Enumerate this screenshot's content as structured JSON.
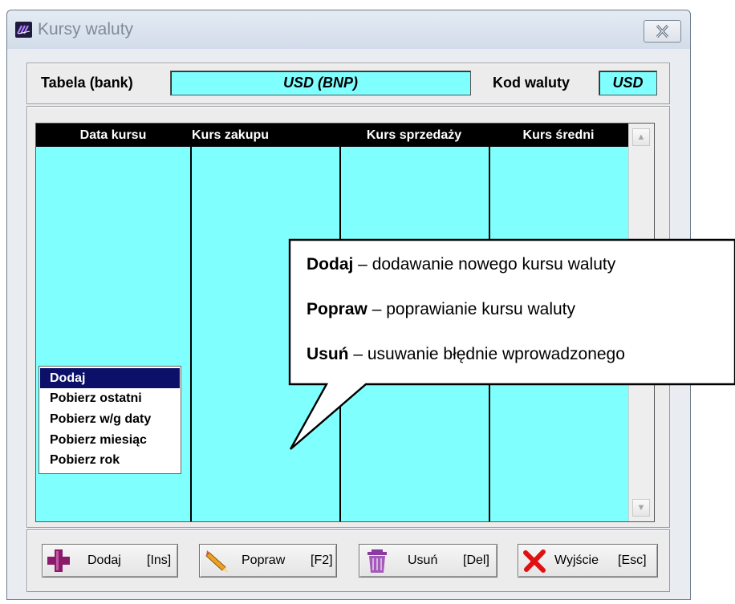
{
  "window": {
    "title": "Kursy waluty"
  },
  "header": {
    "table_label": "Tabela (bank)",
    "table_value": "USD (BNP)",
    "code_label": "Kod waluty",
    "code_value": "USD"
  },
  "grid": {
    "columns": [
      "Data kursu",
      "Kurs zakupu",
      "Kurs sprzedaży",
      "Kurs średni"
    ],
    "rows": []
  },
  "popup_menu": {
    "items": [
      "Dodaj",
      "Pobierz ostatni",
      "Pobierz w/g daty",
      "Pobierz miesiąc",
      "Pobierz rok"
    ],
    "selected": "Dodaj"
  },
  "callout": {
    "lines": [
      {
        "term": "Dodaj",
        "desc": " – dodawanie nowego kursu waluty"
      },
      {
        "term": "Popraw",
        "desc": " – poprawianie kursu waluty"
      },
      {
        "term": "Usuń",
        "desc": " – usuwanie błędnie wprowadzonego"
      }
    ]
  },
  "buttons": {
    "add": {
      "label": "Dodaj",
      "key": "[Ins]"
    },
    "edit": {
      "label": "Popraw",
      "key": "[F2]"
    },
    "delete": {
      "label": "Usuń",
      "key": "[Del]"
    },
    "exit": {
      "label": "Wyjście",
      "key": "[Esc]"
    }
  },
  "colors": {
    "grid_background": "#80ffff",
    "menu_selected": "#0c1068",
    "add_icon": "#8b1a6b",
    "exit_icon": "#e01010"
  },
  "icons": {
    "app": "currency-app-icon",
    "close": "close-icon",
    "add": "plus-icon",
    "edit": "pencil-icon",
    "delete": "trash-icon",
    "exit": "red-x-icon"
  }
}
